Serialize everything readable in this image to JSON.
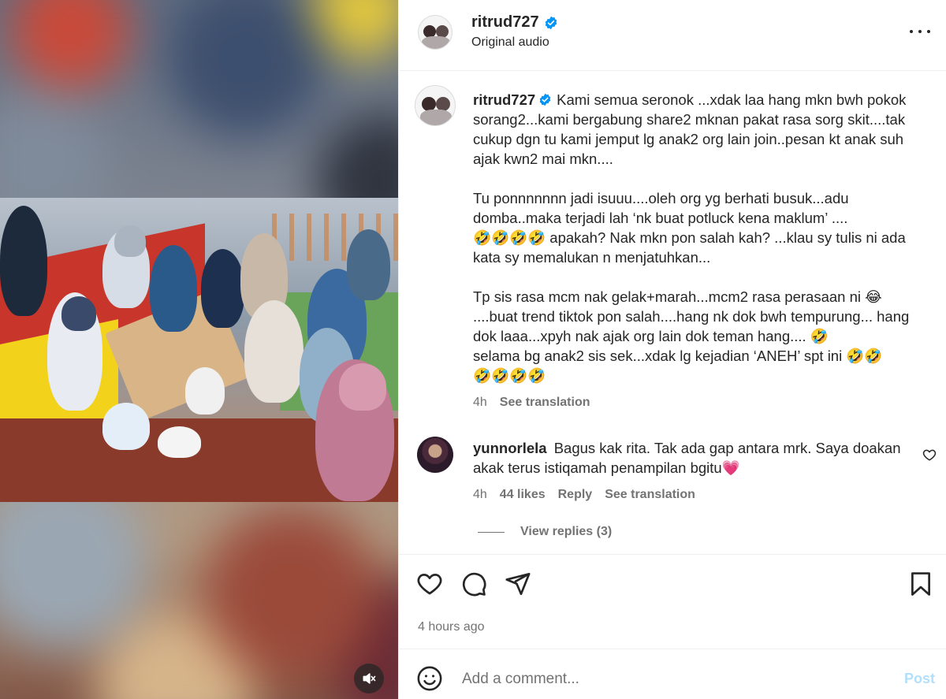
{
  "header": {
    "username": "ritrud727",
    "audio": "Original audio"
  },
  "caption": {
    "username": "ritrud727",
    "p1": "Kami semua seronok ...xdak laa hang mkn bwh pokok sorang2...kami bergabung share2 mknan pakat rasa sorg skit....tak cukup dgn tu kami jemput lg anak2 org lain join..pesan kt anak suh ajak kwn2 mai mkn....",
    "p2": "Tu ponnnnnnn jadi isuuu....oleh org yg berhati busuk...adu domba..maka terjadi lah ‘nk buat potluck kena maklum’ ....\n🤣🤣🤣🤣 apakah? Nak mkn pon salah kah? ...klau sy tulis ni ada kata sy memalukan n menjatuhkan...",
    "p3": "Tp sis rasa mcm nak gelak+marah...mcm2 rasa perasaan ni 😂\n....buat trend tiktok pon salah....hang nk dok bwh tempurung... hang dok laaa...xpyh nak ajak org lain dok teman hang.... 🤣\nselama bg anak2 sis sek...xdak lg kejadian ‘ANEH’ spt ini 🤣🤣\n🤣🤣🤣🤣",
    "time": "4h",
    "see_translation": "See translation"
  },
  "comment": {
    "username": "yunnorlela",
    "text": "Bagus kak rita. Tak ada gap antara mrk. Saya doakan akak terus istiqamah penampilan bgitu💗",
    "time": "4h",
    "likes": "44 likes",
    "reply": "Reply",
    "see_translation": "See translation",
    "view_replies": "View replies (3)"
  },
  "actions": {
    "timestamp": "4 hours ago"
  },
  "add_comment": {
    "placeholder": "Add a comment...",
    "post": "Post"
  },
  "colors": {
    "verified": "#0095f6",
    "post_disabled": "#b2dffc",
    "secondary_text": "#737373",
    "primary_text": "#262626"
  }
}
